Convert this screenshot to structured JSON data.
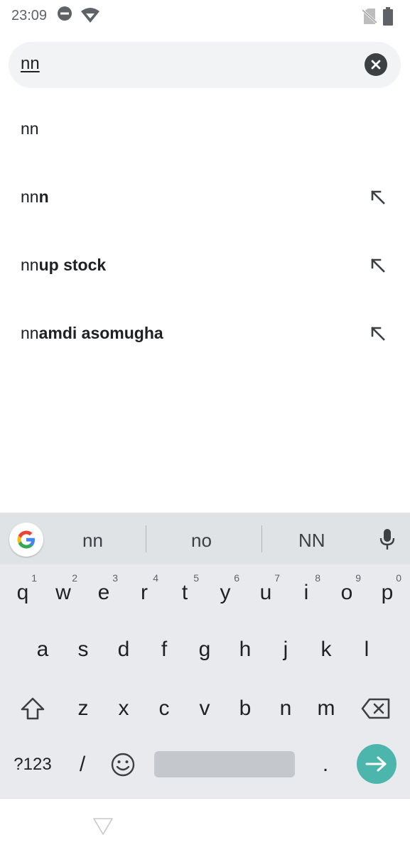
{
  "status_bar": {
    "time": "23:09",
    "icons": [
      "do-not-disturb-icon",
      "wifi-icon",
      "no-sim-icon",
      "battery-icon"
    ]
  },
  "search": {
    "query": "nn",
    "clear_icon": "close-icon"
  },
  "suggestions": [
    {
      "prefix": "nn",
      "rest": "",
      "has_arrow": false
    },
    {
      "prefix": "nn",
      "rest": "n",
      "has_arrow": true
    },
    {
      "prefix": "nn",
      "rest": "up stock",
      "has_arrow": true
    },
    {
      "prefix": "nn",
      "rest": "amdi asomugha",
      "has_arrow": true
    }
  ],
  "keyboard": {
    "suggestions": [
      "nn",
      "no",
      "NN"
    ],
    "row1": [
      "q",
      "w",
      "e",
      "r",
      "t",
      "y",
      "u",
      "i",
      "o",
      "p"
    ],
    "row1_hints": [
      "1",
      "2",
      "3",
      "4",
      "5",
      "6",
      "7",
      "8",
      "9",
      "0"
    ],
    "row2": [
      "a",
      "s",
      "d",
      "f",
      "g",
      "h",
      "j",
      "k",
      "l"
    ],
    "row3": [
      "z",
      "x",
      "c",
      "v",
      "b",
      "n",
      "m"
    ],
    "symbols_label": "?123",
    "slash_label": "/",
    "period_label": ".",
    "accent_color": "#4db6ac"
  }
}
